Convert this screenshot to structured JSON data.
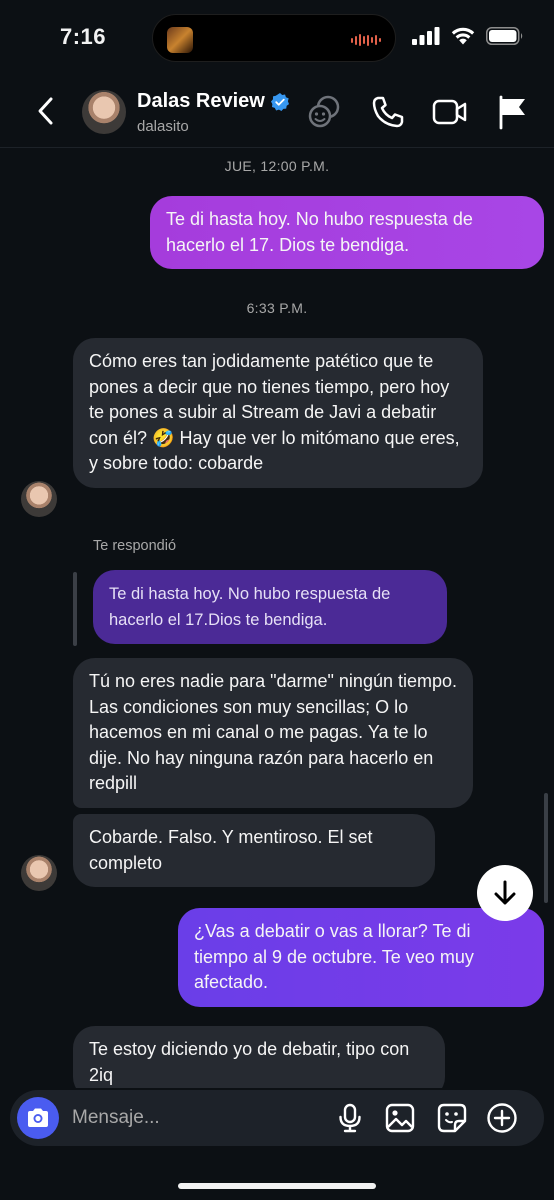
{
  "status_bar": {
    "time": "7:16"
  },
  "header": {
    "contact_name": "Dalas Review",
    "username": "dalasito",
    "verified": true
  },
  "messages": {
    "ts1": "JUE, 12:00 P.M.",
    "out1": "Te di hasta hoy. No hubo respuesta de hacerlo el 17. Dios te bendiga.",
    "ts2": "6:33 P.M.",
    "in1": "Cómo eres tan jodidamente patético que te pones a decir que no tienes tiempo, pero hoy te pones a subir al Stream de Javi a debatir con él? 🤣 Hay que ver lo mitómano que eres, y sobre todo: cobarde",
    "reply_label": "Te respondió",
    "reply_quote": "Te di hasta hoy. No hubo respuesta de hacerlo el 17.Dios te bendiga.",
    "in2": "Tú no eres nadie para \"darme\" ningún tiempo. Las condiciones son muy sencillas; O lo hacemos en mi canal o me pagas. Ya te lo dije. No hay ninguna razón para hacerlo en redpill",
    "in3": "Cobarde. Falso. Y mentiroso. El set completo",
    "out2": "¿Vas a debatir o vas a llorar? Te di tiempo al 9 de octubre. Te veo muy afectado.",
    "in4": "Te estoy diciendo yo de debatir, tipo con 2iq"
  },
  "composer": {
    "placeholder": "Mensaje..."
  },
  "colors": {
    "background": "#0c1014",
    "incoming_bubble": "#262a31",
    "outgoing_bubble_purple": "#a846e6",
    "outgoing_bubble_violet": "#6a3ee8",
    "reply_bubble": "#4b2a96",
    "camera_button": "#4a5cf0",
    "verified_badge": "#3797f0"
  },
  "icons": [
    "back-chevron-icon",
    "verified-badge-icon",
    "effects-icon",
    "phone-icon",
    "video-icon",
    "flag-icon",
    "camera-icon",
    "microphone-icon",
    "gallery-icon",
    "sticker-icon",
    "add-icon",
    "arrow-down-icon"
  ]
}
